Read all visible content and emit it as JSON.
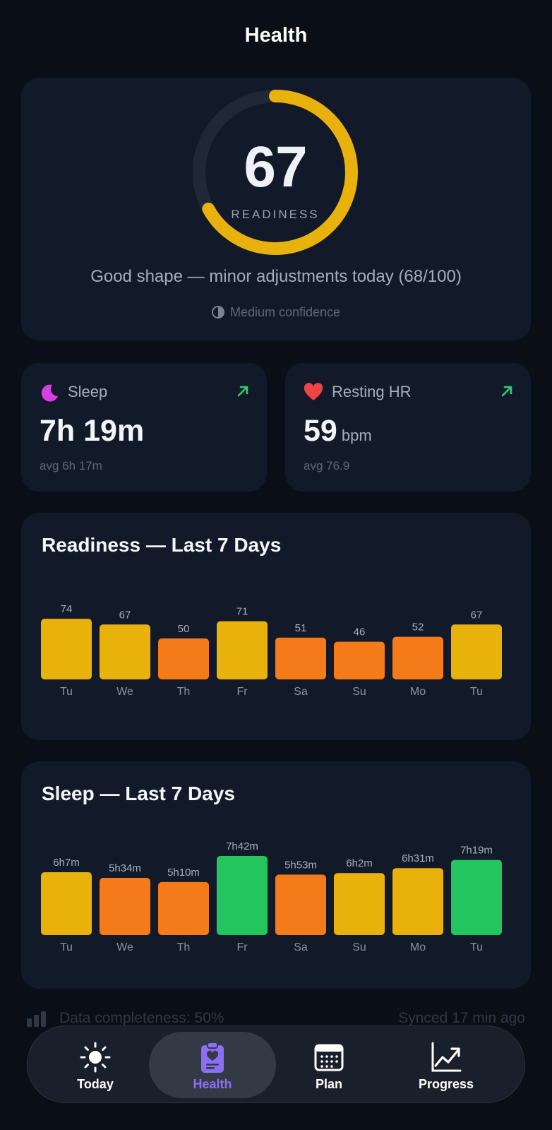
{
  "header": {
    "title": "Health"
  },
  "readiness": {
    "score": "67",
    "score_value": 67,
    "max": 100,
    "label": "READINESS",
    "summary": "Good shape — minor adjustments today (68/100)",
    "confidence": "Medium confidence",
    "ring_color": "#e9b10c",
    "track_color": "#1f2836"
  },
  "metrics": {
    "sleep": {
      "label": "Sleep",
      "icon": "moon-icon",
      "value": "7h 19m",
      "sub": "avg 6h 17m",
      "trend": "up"
    },
    "resting_hr": {
      "label": "Resting HR",
      "icon": "heart-icon",
      "value": "59",
      "unit": "bpm",
      "sub": "avg 76.9",
      "trend": "up"
    }
  },
  "colors": {
    "yellow": "#e9b10c",
    "orange": "#f47a1a",
    "green": "#22c55e",
    "trend_green": "#2ecc71"
  },
  "chart_data": [
    {
      "type": "bar",
      "title": "Readiness — Last 7 Days",
      "categories": [
        "Tu",
        "We",
        "Th",
        "Fr",
        "Sa",
        "Su",
        "Mo",
        "Tu"
      ],
      "values": [
        74,
        67,
        50,
        71,
        51,
        46,
        52,
        67
      ],
      "labels": [
        "74",
        "67",
        "50",
        "71",
        "51",
        "46",
        "52",
        "67"
      ],
      "colors": [
        "#e9b10c",
        "#e9b10c",
        "#f47a1a",
        "#e9b10c",
        "#f47a1a",
        "#f47a1a",
        "#f47a1a",
        "#e9b10c"
      ],
      "ylim": [
        0,
        100
      ],
      "grid": false
    },
    {
      "type": "bar",
      "title": "Sleep — Last 7 Days",
      "categories": [
        "Tu",
        "We",
        "Th",
        "Fr",
        "Sa",
        "Su",
        "Mo",
        "Tu"
      ],
      "values": [
        367,
        334,
        310,
        462,
        353,
        362,
        391,
        439
      ],
      "labels": [
        "6h7m",
        "5h34m",
        "5h10m",
        "7h42m",
        "5h53m",
        "6h2m",
        "6h31m",
        "7h19m"
      ],
      "colors": [
        "#e9b10c",
        "#f47a1a",
        "#f47a1a",
        "#22c55e",
        "#f47a1a",
        "#e9b10c",
        "#e9b10c",
        "#22c55e"
      ],
      "ylim": [
        0,
        462
      ],
      "grid": false
    }
  ],
  "footer": {
    "completeness": "Data completeness: 50%",
    "synced": "Synced 17 min ago"
  },
  "tabs": [
    {
      "label": "Today",
      "icon": "sun-icon",
      "active": false
    },
    {
      "label": "Health",
      "icon": "clipboard-heart-icon",
      "active": true
    },
    {
      "label": "Plan",
      "icon": "calendar-icon",
      "active": false
    },
    {
      "label": "Progress",
      "icon": "chart-line-icon",
      "active": false
    }
  ]
}
